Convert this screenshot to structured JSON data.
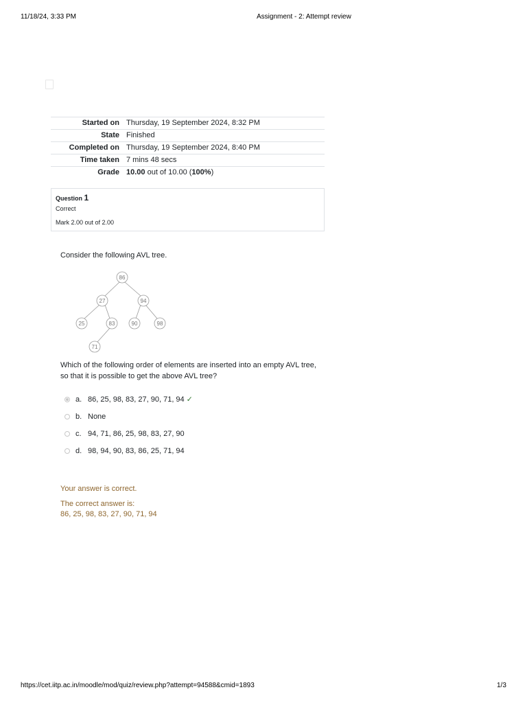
{
  "print_header": {
    "datetime": "11/18/24, 3:33 PM",
    "title": "Assignment - 2: Attempt review"
  },
  "summary": [
    {
      "label": "Started on",
      "value": "Thursday, 19 September 2024, 8:32 PM"
    },
    {
      "label": "State",
      "value": "Finished"
    },
    {
      "label": "Completed on",
      "value": "Thursday, 19 September 2024, 8:40 PM"
    },
    {
      "label": "Time taken",
      "value": "7 mins 48 secs"
    },
    {
      "label": "Grade",
      "value_bold": "10.00",
      "value_mid": " out of 10.00 (",
      "value_pct": "100%",
      "value_end": ")"
    }
  ],
  "question": {
    "label": "Question",
    "number": "1",
    "state": "Correct",
    "mark": "Mark 2.00 out of 2.00",
    "text": "Consider the following AVL tree.",
    "prompt": "Which of the following order of elements are inserted into an empty AVL tree, so that it is possible to get the above AVL tree?",
    "tree_nodes": [
      "86",
      "27",
      "94",
      "25",
      "83",
      "90",
      "98",
      "71"
    ],
    "options": [
      {
        "letter": "a.",
        "text": "86, 25, 98, 83, 27, 90, 71, 94",
        "selected": true,
        "correct_mark": "✓"
      },
      {
        "letter": "b.",
        "text": "None",
        "selected": false
      },
      {
        "letter": "c.",
        "text": "94, 71, 86, 25, 98, 83, 27, 90",
        "selected": false
      },
      {
        "letter": "d.",
        "text": "98, 94, 90, 83, 86, 25, 71, 94",
        "selected": false
      }
    ],
    "feedback": {
      "result": "Your answer is correct.",
      "correct_label": "The correct answer is:",
      "correct_value": "86, 25, 98, 83, 27, 90, 71, 94"
    }
  },
  "print_footer": {
    "url": "https://cet.iitp.ac.in/moodle/mod/quiz/review.php?attempt=94588&cmid=1893",
    "page": "1/3"
  },
  "colors": {
    "feedback": "#8e662e",
    "check": "#357a32",
    "border": "#dee2e6"
  }
}
